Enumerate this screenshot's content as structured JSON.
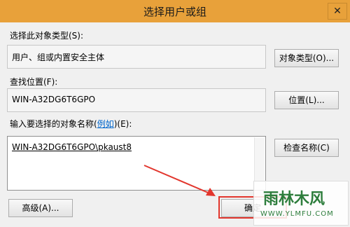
{
  "window": {
    "title": "选择用户或组",
    "close_glyph": "✕"
  },
  "object_type": {
    "label": "选择此对象类型(S):",
    "value": "用户、组或内置安全主体",
    "button": "对象类型(O)..."
  },
  "location": {
    "label": "查找位置(F):",
    "value": "WIN-A32DG6T6GPO",
    "button": "位置(L)..."
  },
  "names": {
    "label_prefix": "输入要选择的对象名称(",
    "label_link": "例如",
    "label_suffix": ")(E):",
    "value": "WIN-A32DG6T6GPO\\pkaust8",
    "check_button": "检查名称(C)"
  },
  "footer": {
    "advanced_button": "高级(A)...",
    "ok_button": "确定"
  },
  "watermark": {
    "line1": "雨林木风",
    "line2": "WWW.YLMFU.COM"
  },
  "colors": {
    "titlebar": "#e8a13a",
    "highlight": "#e2362d",
    "link": "#0066cc"
  }
}
